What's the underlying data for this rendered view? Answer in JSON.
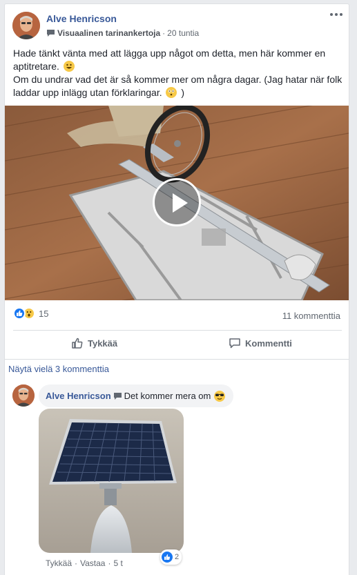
{
  "post": {
    "author": "Alve Henricson",
    "group_badge": "Visuaalinen tarinankertoja",
    "separator": "·",
    "time": "20 tuntia",
    "text_line1": "Hade tänkt vänta med att lägga upp något om detta, men här kommer en aptitretare.",
    "text_line2": "Om du undrar vad det är så kommer mer om några dagar. (Jag hatar när folk laddar upp inlägg utan förklaringar.",
    "text_line2_end": ")",
    "video_icon": "play-icon",
    "reaction_count": "15",
    "comment_count": "11 kommenttia",
    "like_label": "Tykkää",
    "comment_label": "Kommentti"
  },
  "comments": {
    "view_more": "Näytä vielä 3 kommenttia",
    "items": [
      {
        "author": "Alve Henricson",
        "text": "Det kommer mera om",
        "like": "Tykkää",
        "reply": "Vastaa",
        "time": "5 t",
        "reaction_count": "2"
      }
    ]
  },
  "colors": {
    "link": "#385898",
    "facebook_blue": "#1877f2",
    "muted": "#606770",
    "background": "#e9ebee"
  }
}
